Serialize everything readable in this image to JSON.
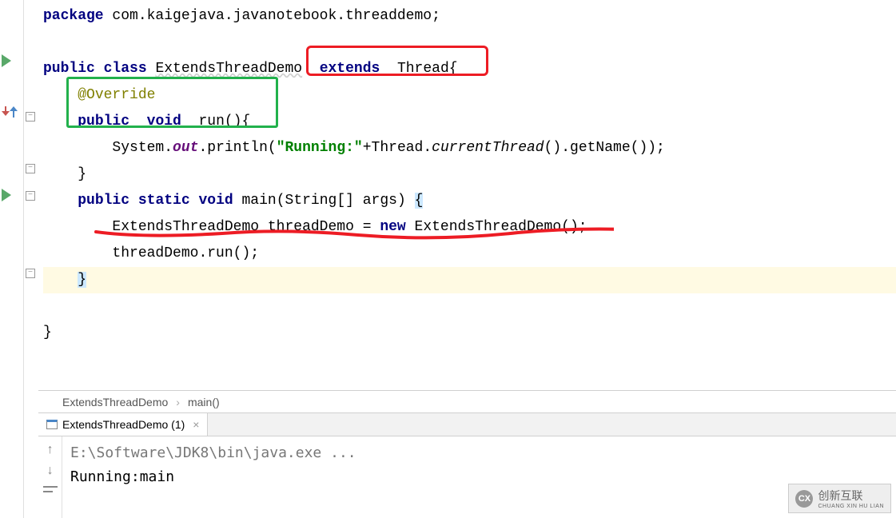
{
  "code": {
    "package_kw": "package",
    "package_name": " com.kaigejava.javanotebook.threaddemo;",
    "public": "public",
    "class": "class",
    "classname": "ExtendsThreadDemo",
    "extends": "extends",
    "superclass": "Thread",
    "override": "@Override",
    "void": "void",
    "run": "run",
    "system": "System",
    "out": "out",
    "println": "println",
    "running_str": "\"Running:\"",
    "thread": "Thread",
    "currentThread": "currentThread",
    "getName": "getName",
    "static": "static",
    "main": "main",
    "main_args": "(String[] args)",
    "var_decl_type": "ExtendsThreadDemo",
    "var_decl_name": "threadDemo",
    "new": "new",
    "ctor": "ExtendsThreadDemo",
    "invoke": "threadDemo.run();",
    "brace_open": "{",
    "brace_close": "}",
    "paren_empty": "()",
    "semicolon": ";"
  },
  "breadcrumb": {
    "class": "ExtendsThreadDemo",
    "method": "main()",
    "sep": "›"
  },
  "tab": {
    "label": "ExtendsThreadDemo (1)"
  },
  "console": {
    "path": "E:\\Software\\JDK8\\bin\\java.exe ...",
    "output": "Running:main"
  },
  "watermark": {
    "logo": "CX",
    "text1": "创新互联",
    "text2": "CHUANG XIN HU LIAN"
  }
}
